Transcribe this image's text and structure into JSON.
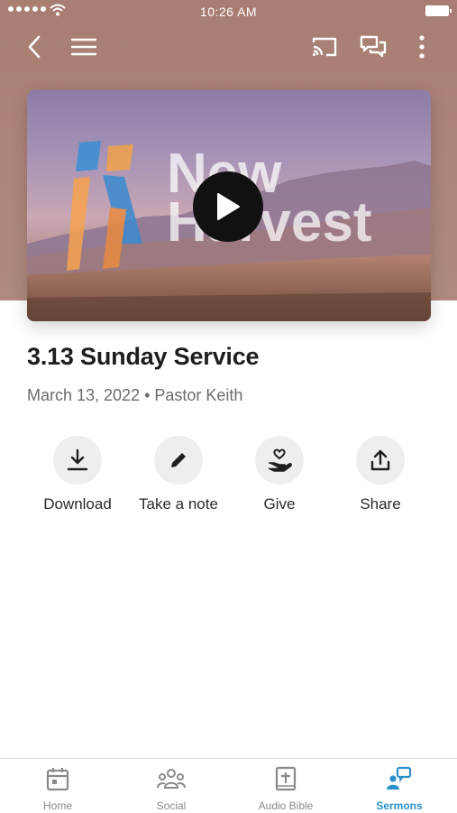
{
  "status_bar": {
    "time": "10:26 AM"
  },
  "toolbar": {
    "back_icon": "chevron-left-icon",
    "menu_icon": "hamburger-menu-icon",
    "cast_icon": "cast-icon",
    "chat_icon": "chat-bubbles-icon",
    "more_icon": "more-vertical-icon"
  },
  "video": {
    "thumbnail_text_line1": "New",
    "thumbnail_text_line2": "Harvest",
    "play_icon": "play-icon"
  },
  "sermon": {
    "title": "3.13 Sunday Service",
    "meta": "March 13, 2022 • Pastor Keith"
  },
  "actions": [
    {
      "label": "Download",
      "icon": "download-icon"
    },
    {
      "label": "Take a note",
      "icon": "pencil-icon"
    },
    {
      "label": "Give",
      "icon": "give-hand-heart-icon"
    },
    {
      "label": "Share",
      "icon": "share-upload-icon"
    }
  ],
  "tabs": [
    {
      "label": "Home",
      "icon": "calendar-icon",
      "active": false
    },
    {
      "label": "Social",
      "icon": "people-group-icon",
      "active": false
    },
    {
      "label": "Audio Bible",
      "icon": "bible-icon",
      "active": false
    },
    {
      "label": "Sermons",
      "icon": "sermons-icon",
      "active": true
    }
  ],
  "colors": {
    "header": "#ad8478",
    "accent": "#2d8fc9",
    "tab_inactive": "#8a8a8a"
  }
}
